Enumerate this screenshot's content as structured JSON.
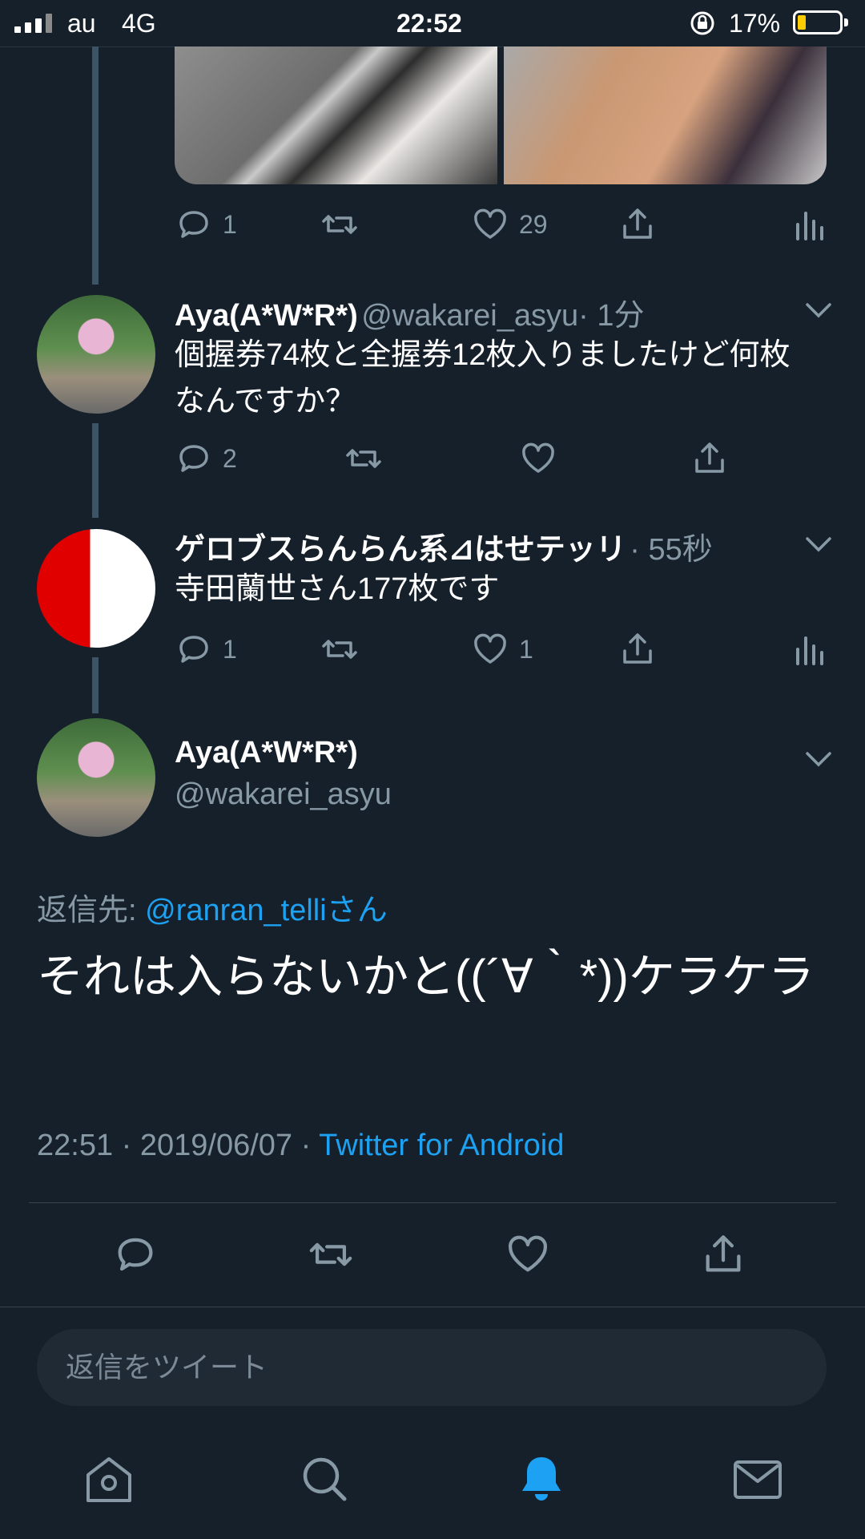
{
  "status_bar": {
    "carrier": "au",
    "network": "4G",
    "time": "22:52",
    "battery_percent": "17%",
    "battery_level": 0.17,
    "icons": [
      "signal-icon",
      "rotation-lock-icon",
      "battery-icon"
    ]
  },
  "tweets": [
    {
      "actions": {
        "reply_count": "1",
        "retweet_count": "",
        "like_count": "29",
        "has_analytics": true
      }
    },
    {
      "display_name": "Aya(A*W*R*)",
      "handle": "@wakarei_asyu",
      "time": "· 1分",
      "text": "個握券74枚と全握券12枚入りましたけど何枚なんですか？",
      "actions": {
        "reply_count": "2",
        "retweet_count": "",
        "like_count": ""
      }
    },
    {
      "display_name": "ゲロブスらんらん系⊿はせテッリ",
      "time": "· 55秒",
      "text": "寺田蘭世さん177枚です",
      "actions": {
        "reply_count": "1",
        "retweet_count": "",
        "like_count": "1",
        "has_analytics": true
      }
    }
  ],
  "focus_tweet": {
    "display_name": "Aya(A*W*R*)",
    "handle": "@wakarei_asyu",
    "reply_to_label": "返信先:",
    "reply_to_user": "@ranran_telliさん",
    "text": "それは入らないかと((´∀｀*))ケラケラ",
    "timestamp": "22:51 · 2019/06/07 · ",
    "source": "Twitter for Android"
  },
  "reply_box": {
    "placeholder": "返信をツイート"
  },
  "tab_bar": {
    "items": [
      "home-icon",
      "search-icon",
      "notifications-icon",
      "messages-icon"
    ],
    "active": "notifications-icon",
    "active_color": "#1da1f2"
  },
  "colors": {
    "background": "#15202b",
    "accent": "#1da1f2",
    "muted": "#8899a6"
  }
}
